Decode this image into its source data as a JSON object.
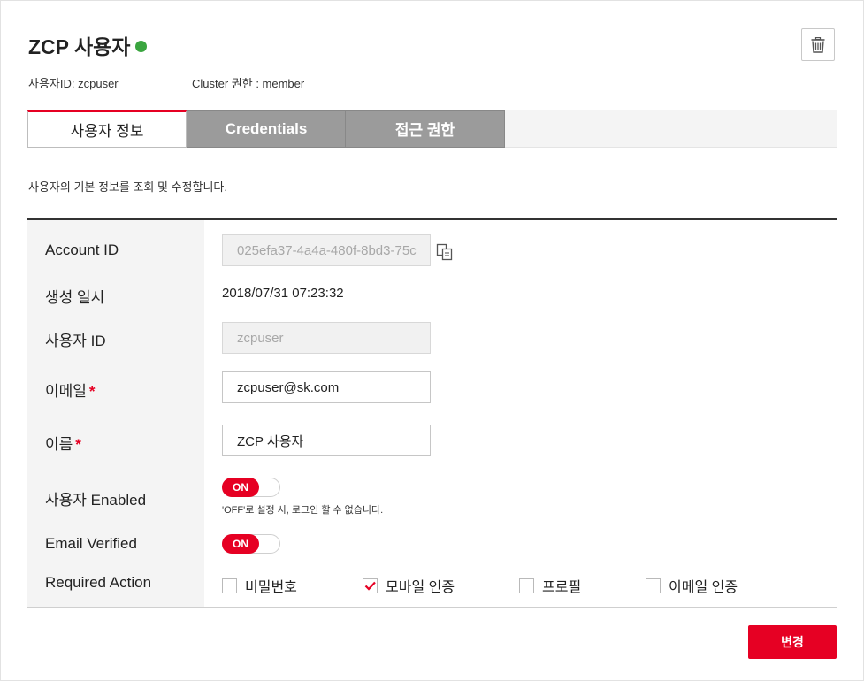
{
  "header": {
    "title": "ZCP 사용자",
    "status_color": "#3aa53f",
    "delete_icon": "trash-icon",
    "user_id_text": "사용자ID: zcpuser",
    "cluster_role_text": "Cluster 권한 : member"
  },
  "tabs": [
    {
      "label": "사용자 정보",
      "active": true
    },
    {
      "label": "Credentials",
      "active": false
    },
    {
      "label": "접근 권한",
      "active": false
    }
  ],
  "description": "사용자의 기본 정보를 조회 및 수정합니다.",
  "form": {
    "account_id": {
      "label": "Account ID",
      "value": "025efa37-4a4a-480f-8bd3-75c",
      "copy_icon": "copy-icon"
    },
    "created_at": {
      "label": "생성 일시",
      "value": "2018/07/31 07:23:32"
    },
    "user_id": {
      "label": "사용자 ID",
      "value": "zcpuser"
    },
    "email": {
      "label": "이메일",
      "required_mark": "*",
      "value": "zcpuser@sk.com"
    },
    "name": {
      "label": "이름",
      "required_mark": "*",
      "value": "ZCP 사용자"
    },
    "enabled": {
      "label": "사용자 Enabled",
      "toggle": "ON",
      "hint": "'OFF'로 설정 시, 로그인 할 수 없습니다."
    },
    "email_verified": {
      "label": "Email Verified",
      "toggle": "ON"
    },
    "required_action": {
      "label": "Required Action",
      "options": [
        {
          "label": "비밀번호",
          "checked": false
        },
        {
          "label": "모바일 인증",
          "checked": true
        },
        {
          "label": "프로필",
          "checked": false
        },
        {
          "label": "이메일 인증",
          "checked": false
        }
      ]
    }
  },
  "actions": {
    "submit_label": "변경",
    "accent_color": "#e60023"
  }
}
